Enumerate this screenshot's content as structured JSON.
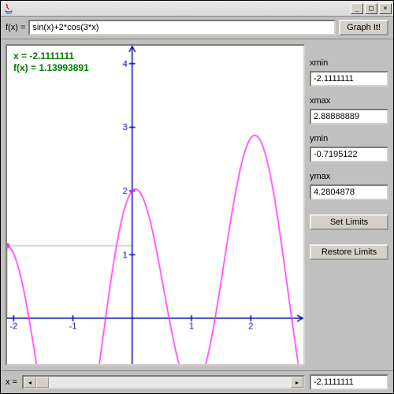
{
  "window": {
    "title": ""
  },
  "toprow": {
    "fx_label": "f(x) = ",
    "formula": "sin(x)+2*cos(3*x)",
    "graph_btn": "Graph It!"
  },
  "readout": {
    "x_line": "x = -2.1111111",
    "fx_line": "f(x) = 1.13993891"
  },
  "chart_data": {
    "type": "line",
    "title": "",
    "xlabel": "",
    "ylabel": "",
    "xlim": [
      -2.1111111,
      2.88888889
    ],
    "ylim": [
      -0.7195122,
      4.2804878
    ],
    "x_ticks": [
      -2,
      -1,
      1,
      2
    ],
    "y_ticks": [
      1,
      2,
      3,
      4
    ],
    "formula": "sin(x)+2*cos(3*x)",
    "marker": {
      "x": -2.1111111,
      "y": 1.13993891
    },
    "series": [
      {
        "name": "f(x)",
        "color": "#ff33ff",
        "formula": "sin(x)+2*cos(3*x)"
      }
    ]
  },
  "side": {
    "xmin_label": "xmin",
    "xmin": "-2.1111111",
    "xmax_label": "xmax",
    "xmax": "2.88888889",
    "ymin_label": "ymin",
    "ymin": "-0.7195122",
    "ymax_label": "ymax",
    "ymax": "4.2804878",
    "set_limits_btn": "Set Limits",
    "restore_limits_btn": "Restore Limits"
  },
  "bottomrow": {
    "x_label": "x = ",
    "x_value": "-2.1111111"
  },
  "colors": {
    "curve": "#ff33ff",
    "axis": "#0000aa",
    "readout": "#008000",
    "crosshair": "#b0b0b0",
    "marker": "#ff33ff"
  }
}
